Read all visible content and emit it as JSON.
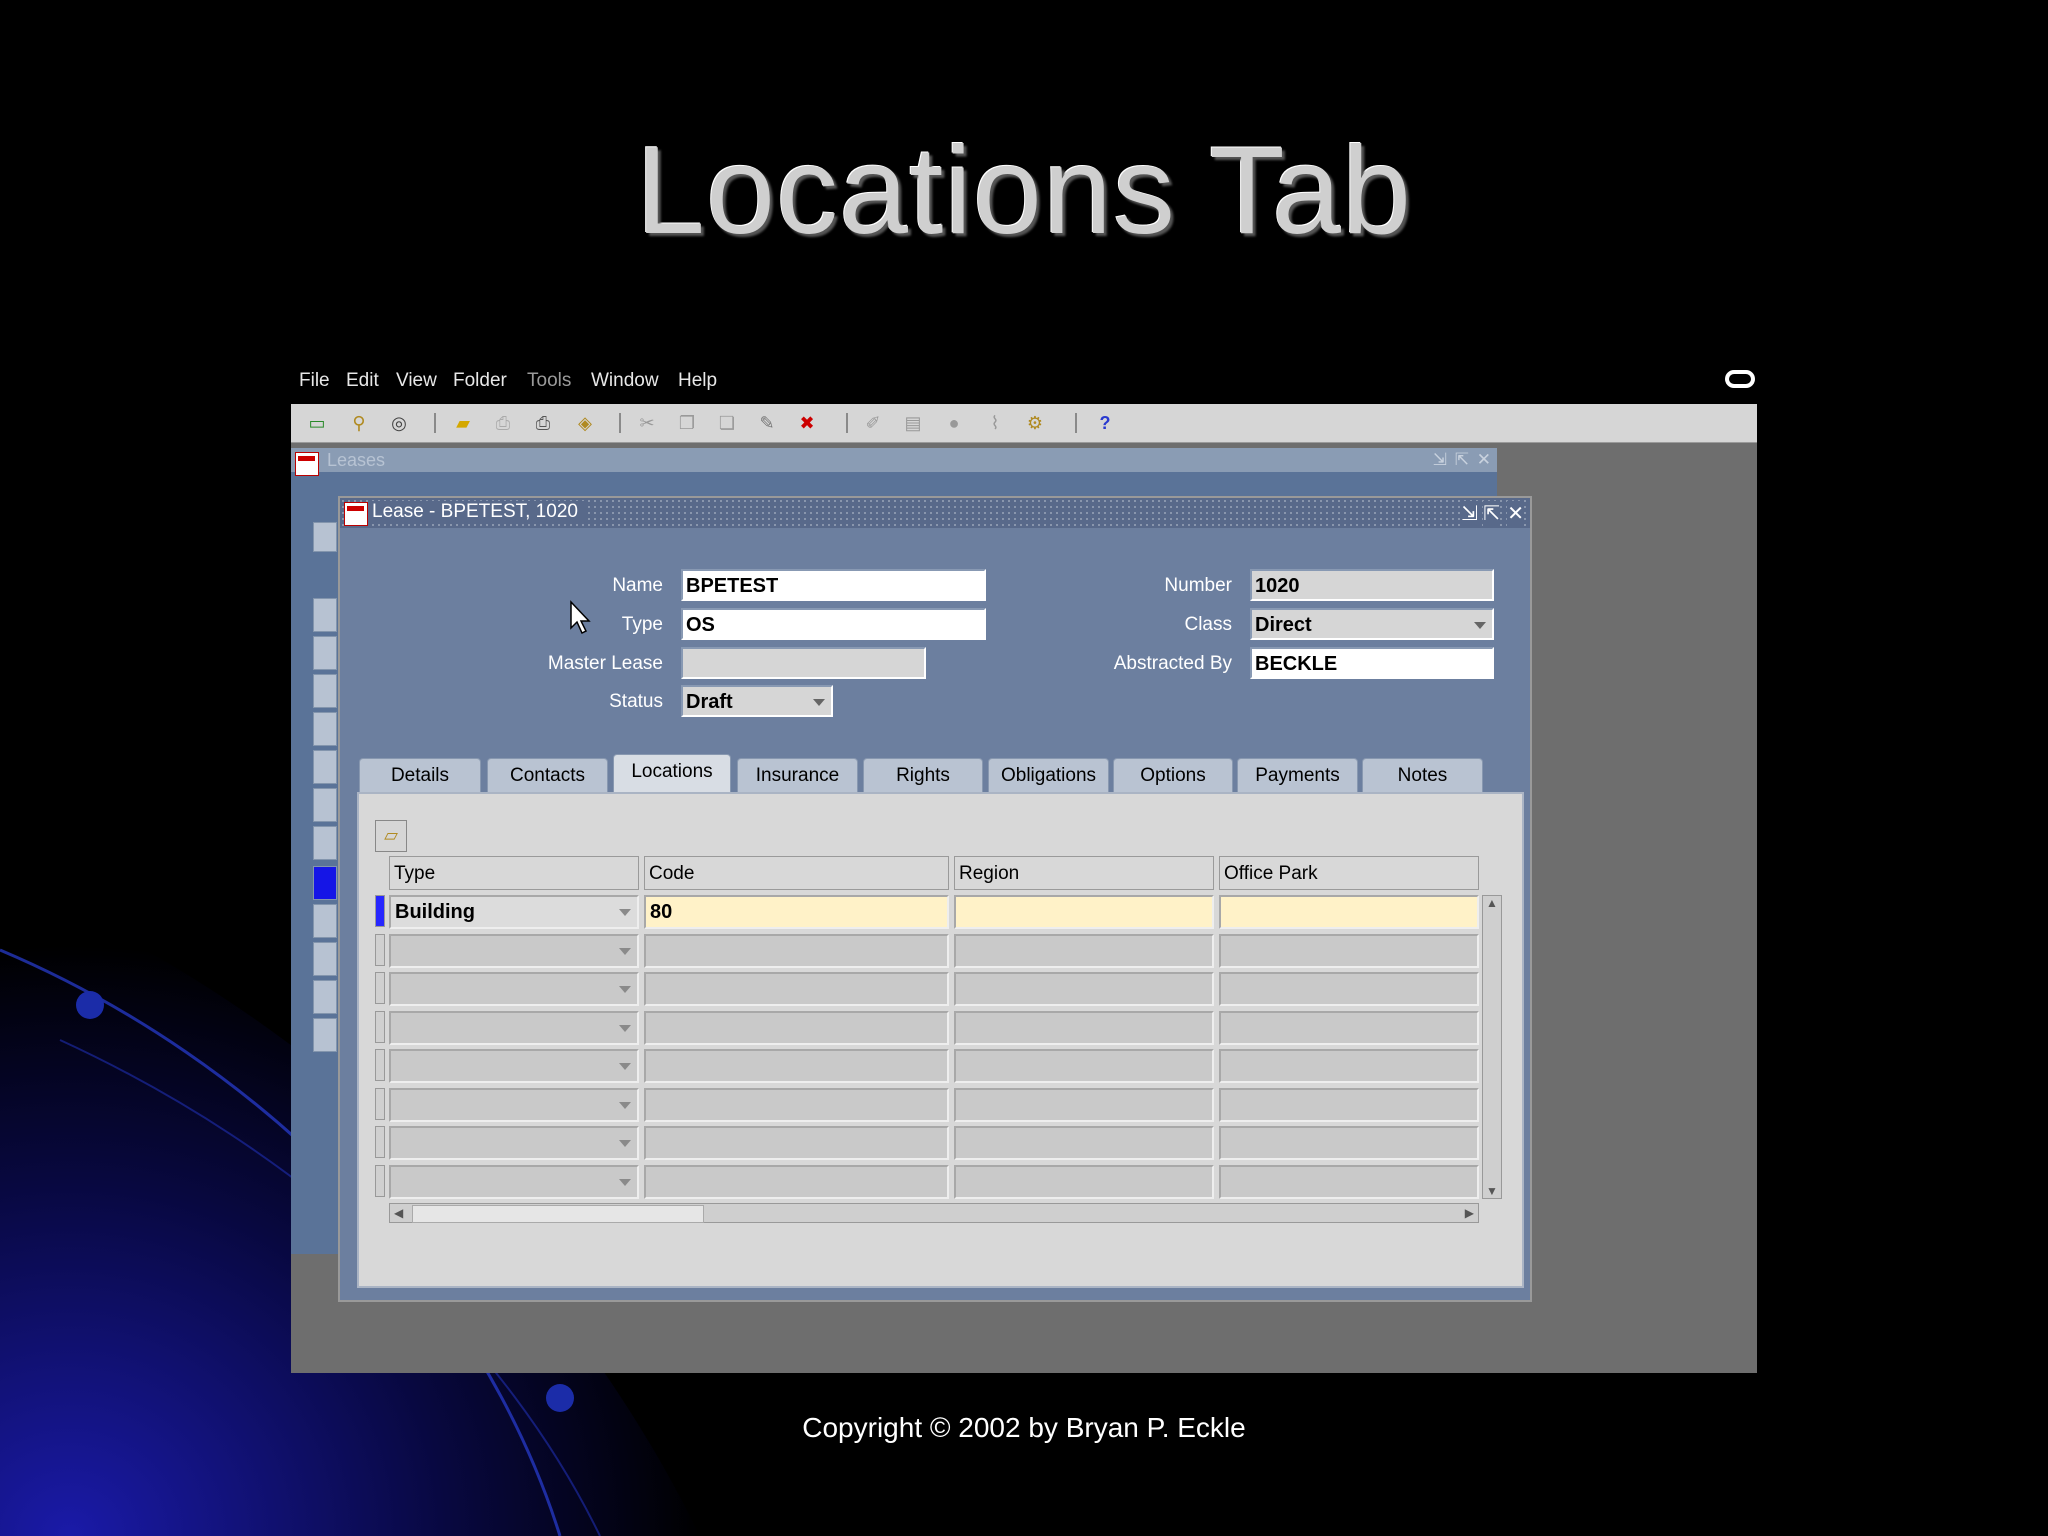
{
  "slide": {
    "title": "Locations Tab",
    "copyright": "Copyright © 2002 by Bryan P. Eckle"
  },
  "menubar": {
    "items": [
      {
        "key": "file",
        "label": "File"
      },
      {
        "key": "edit",
        "label": "Edit"
      },
      {
        "key": "view",
        "label": "View"
      },
      {
        "key": "folder",
        "label": "Folder"
      },
      {
        "key": "tools",
        "label": "Tools",
        "disabled": true
      },
      {
        "key": "window",
        "label": "Window"
      },
      {
        "key": "help",
        "label": "Help"
      }
    ]
  },
  "toolbar": {
    "icons": [
      "new-record-icon",
      "find-icon",
      "navigator-icon",
      "save-icon",
      "print-icon",
      "print-preview-icon",
      "zoom-icon",
      "cut-icon",
      "copy-icon",
      "paste-icon",
      "edit-field-icon",
      "clear-record-icon",
      "delete-record-icon",
      "translations-icon",
      "attachments-icon",
      "folder-tools-icon",
      "clip-icon",
      "help-icon"
    ]
  },
  "windows": {
    "leases_title": "Leases",
    "lease_title": "Lease - BPETEST, 1020"
  },
  "header_form": {
    "name_label": "Name",
    "name_value": "BPETEST",
    "type_label": "Type",
    "type_value": "OS",
    "master_lease_label": "Master Lease",
    "master_lease_value": "",
    "status_label": "Status",
    "status_value": "Draft",
    "number_label": "Number",
    "number_value": "1020",
    "class_label": "Class",
    "class_value": "Direct",
    "abstracted_by_label": "Abstracted By",
    "abstracted_by_value": "BECKLE"
  },
  "tabs": [
    {
      "label": "Details"
    },
    {
      "label": "Contacts"
    },
    {
      "label": "Locations",
      "active": true
    },
    {
      "label": "Insurance"
    },
    {
      "label": "Rights"
    },
    {
      "label": "Obligations"
    },
    {
      "label": "Options"
    },
    {
      "label": "Payments"
    },
    {
      "label": "Notes"
    }
  ],
  "locations_table": {
    "columns": [
      "Type",
      "Code",
      "Region",
      "Office Park"
    ],
    "rows": [
      {
        "type": "Building",
        "code": "80",
        "region": "",
        "office_park": ""
      },
      {
        "type": "",
        "code": "",
        "region": "",
        "office_park": ""
      },
      {
        "type": "",
        "code": "",
        "region": "",
        "office_park": ""
      },
      {
        "type": "",
        "code": "",
        "region": "",
        "office_park": ""
      },
      {
        "type": "",
        "code": "",
        "region": "",
        "office_park": ""
      },
      {
        "type": "",
        "code": "",
        "region": "",
        "office_park": ""
      },
      {
        "type": "",
        "code": "",
        "region": "",
        "office_park": ""
      },
      {
        "type": "",
        "code": "",
        "region": "",
        "office_park": ""
      }
    ]
  },
  "colors": {
    "form_bg": "#6c7f9f",
    "active_row_marker": "#2626ff",
    "current_cell": "#fff2c8"
  }
}
